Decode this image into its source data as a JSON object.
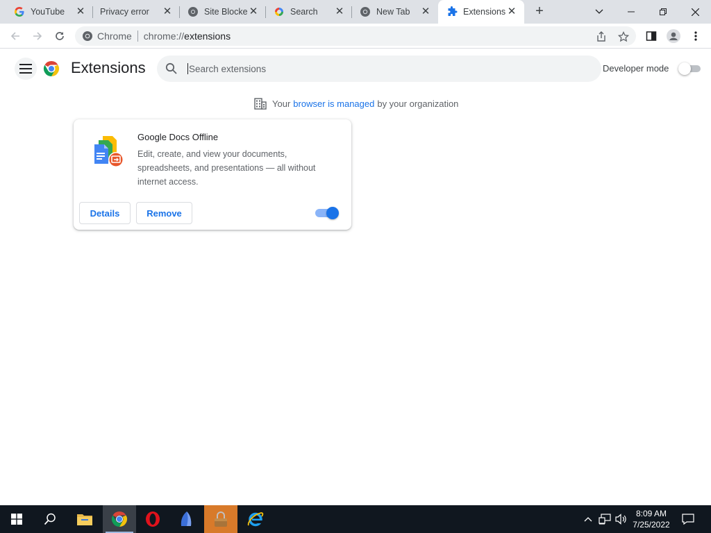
{
  "tabs": [
    {
      "title": "YouTube",
      "icon": "google-g-icon",
      "close": "✕"
    },
    {
      "title": "Privacy error",
      "icon": "none",
      "close": "✕"
    },
    {
      "title": "Site Blocker",
      "icon": "globe-icon",
      "close": "✕"
    },
    {
      "title": "Search",
      "icon": "search-engine-icon",
      "close": "✕"
    },
    {
      "title": "New Tab",
      "icon": "chrome-icon",
      "close": "✕"
    },
    {
      "title": "Extensions",
      "icon": "puzzle-icon",
      "close": "✕"
    }
  ],
  "new_tab_label": "+",
  "omnibox": {
    "site_label": "Chrome",
    "url_scheme": "chrome://",
    "url_path": "extensions"
  },
  "extensions_page": {
    "title": "Extensions",
    "search_placeholder": "Search extensions",
    "developer_mode_label": "Developer mode",
    "developer_mode_on": false,
    "managed_prefix": "Your",
    "managed_link": "browser is managed",
    "managed_suffix": "by your organization"
  },
  "extension_card": {
    "name": "Google Docs Offline",
    "description": "Edit, create, and view your documents, spreadsheets, and presentations — all without internet access.",
    "details_label": "Details",
    "remove_label": "Remove",
    "enabled": true
  },
  "taskbar": {
    "time": "8:09 AM",
    "date": "7/25/2022"
  },
  "colors": {
    "accent": "#1a73e8",
    "tabstrip": "#dee1e6",
    "taskbar": "#10171f"
  }
}
